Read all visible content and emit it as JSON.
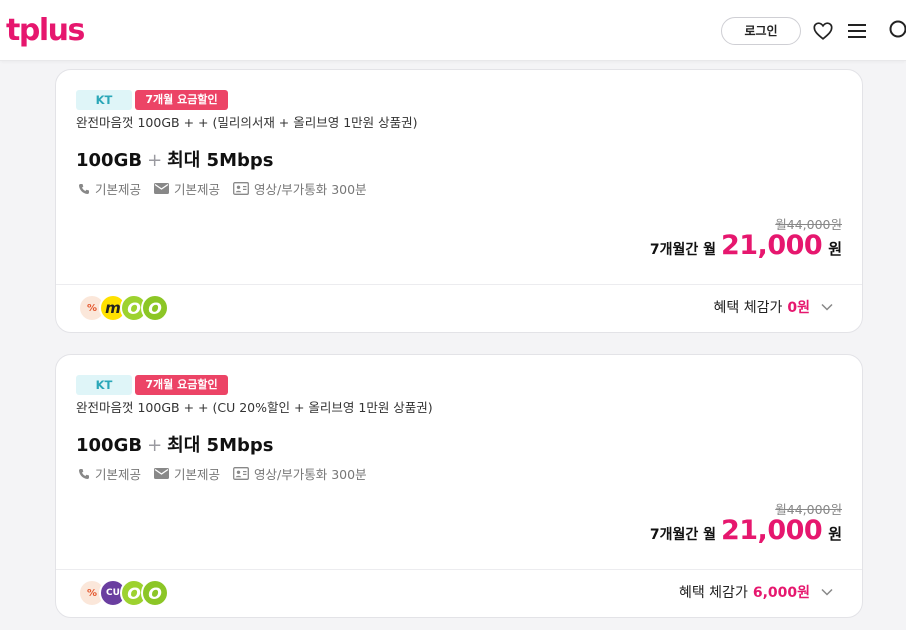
{
  "header": {
    "logo": "tplus",
    "login_label": "로그인",
    "icons": [
      "heart-icon",
      "menu-icon",
      "search-icon"
    ]
  },
  "colors": {
    "accent": "#e6176e",
    "badge_carrier_bg": "#dff5f8",
    "badge_carrier_text": "#2aa7b8",
    "badge_discount_bg": "#ec4466"
  },
  "plans": [
    {
      "carrier": "KT",
      "discount_badge": "7개월 요금할인",
      "description": "완전마음껏 100GB + + (밀리의서재 + 올리브영 1만원 상품권)",
      "data": "100GB",
      "plus": "+",
      "speed": "최대 5Mbps",
      "features": [
        "기본제공",
        "기본제공",
        "영상/부가통화 300분"
      ],
      "original_price": "월44,000원",
      "price_label": "7개월간 월",
      "price": "21,000",
      "price_unit": "원",
      "benefit_label": "혜택 체감가",
      "benefit_value": "0원",
      "benefit_icons": [
        "percent-icon",
        "m-icon",
        "o-icon",
        "o-icon"
      ]
    },
    {
      "carrier": "KT",
      "discount_badge": "7개월 요금할인",
      "description": "완전마음껏 100GB + + (CU 20%할인 + 올리브영 1만원 상품권)",
      "data": "100GB",
      "plus": "+",
      "speed": "최대 5Mbps",
      "features": [
        "기본제공",
        "기본제공",
        "영상/부가통화 300분"
      ],
      "original_price": "월44,000원",
      "price_label": "7개월간 월",
      "price": "21,000",
      "price_unit": "원",
      "benefit_label": "혜택 체감가",
      "benefit_value": "6,000원",
      "benefit_icons": [
        "percent-icon",
        "cu-icon",
        "o-icon",
        "o-icon"
      ]
    }
  ]
}
